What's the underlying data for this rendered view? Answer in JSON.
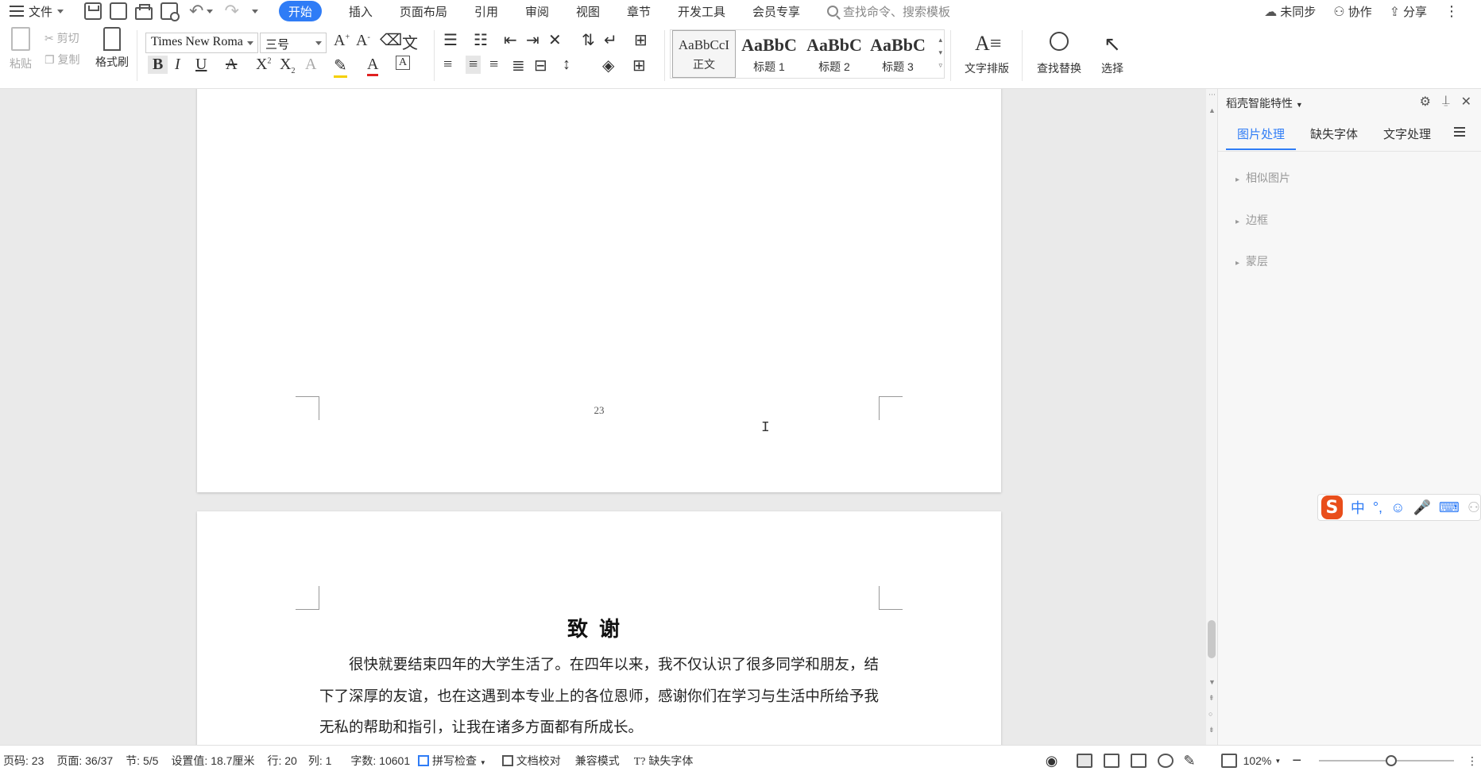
{
  "menubar": {
    "file": "文件",
    "tabs": [
      "开始",
      "插入",
      "页面布局",
      "引用",
      "审阅",
      "视图",
      "章节",
      "开发工具",
      "会员专享"
    ],
    "search_placeholder": "查找命令、搜索模板",
    "sync": "未同步",
    "collab": "协作",
    "share": "分享"
  },
  "ribbon": {
    "paste": "粘贴",
    "cut": "剪切",
    "copy": "复制",
    "format_painter": "格式刷",
    "font_name": "Times New Roma",
    "font_size": "三号",
    "styles": [
      {
        "sample": "AaBbCcI",
        "label": "正文"
      },
      {
        "sample": "AaBbC",
        "label": "标题 1"
      },
      {
        "sample": "AaBbC",
        "label": "标题 2"
      },
      {
        "sample": "AaBbC",
        "label": "标题 3"
      }
    ],
    "text_layout": "文字排版",
    "find_replace": "查找替换",
    "select": "选择"
  },
  "document": {
    "page_number": "23",
    "ack_title": "致谢",
    "ack_body": "很快就要结束四年的大学生活了。在四年以来，我不仅认识了很多同学和朋友，结下了深厚的友谊，也在这遇到本专业上的各位恩师，感谢你们在学习与生活中所给予我无私的帮助和指引，让我在诸多方面都有所成长。"
  },
  "side_panel": {
    "title": "稻壳智能特性",
    "tabs": [
      "图片处理",
      "缺失字体",
      "文字处理"
    ],
    "items": [
      "相似图片",
      "边框",
      "蒙层"
    ]
  },
  "ime": {
    "mode": "中"
  },
  "statusbar": {
    "page_code": "页码: 23",
    "page": "页面: 36/37",
    "section": "节: 5/5",
    "setting": "设置值: 18.7厘米",
    "row": "行: 20",
    "col": "列: 1",
    "word_count": "字数: 10601",
    "spell_check": "拼写检查",
    "doc_check": "文档校对",
    "compat_mode": "兼容模式",
    "missing_font": "缺失字体",
    "zoom": "102%"
  },
  "colors": {
    "accent": "#2f7cf6",
    "ime_logo": "#e94e1b"
  }
}
